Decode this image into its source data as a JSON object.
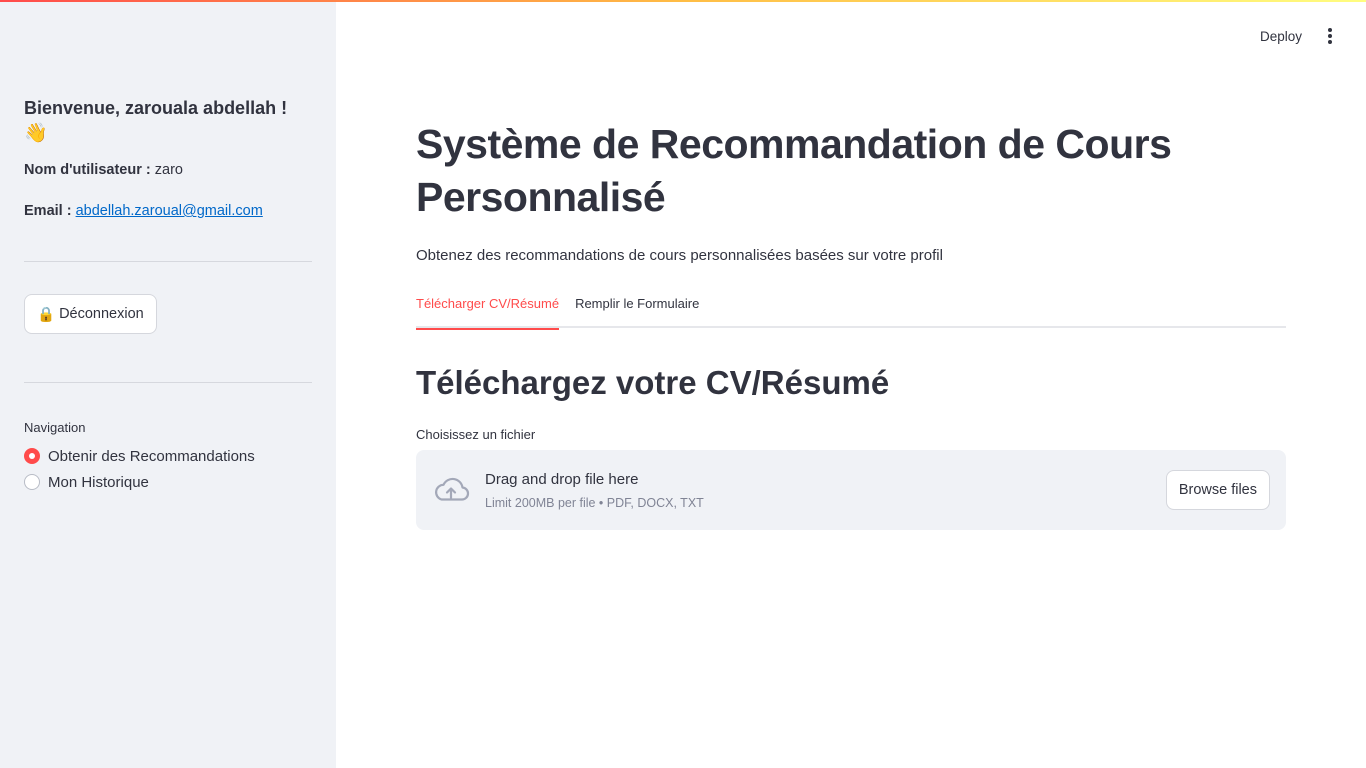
{
  "app": {
    "accent_color": "#ff4b4b",
    "link_color": "#0068c9",
    "sidebar_bg": "#f0f2f6"
  },
  "header": {
    "deploy_label": "Deploy",
    "menu_icon": "kebab-menu-icon"
  },
  "sidebar": {
    "welcome": "Bienvenue, zarouala abdellah !",
    "wave_emoji": "👋",
    "username_label": "Nom d'utilisateur :",
    "username_value": "zaro",
    "email_label": "Email :",
    "email_value": "abdellah.zaroual@gmail.com",
    "logout_icon": "🔒",
    "logout_label": "Déconnexion",
    "nav_title": "Navigation",
    "nav_items": [
      {
        "label": "Obtenir des Recommandations",
        "selected": true
      },
      {
        "label": "Mon Historique",
        "selected": false
      }
    ]
  },
  "main": {
    "title": "Système de Recommandation de Cours Personnalisé",
    "subtitle": "Obtenez des recommandations de cours personnalisées basées sur votre profil",
    "tabs": [
      {
        "label": "Télécharger CV/Résumé",
        "active": true
      },
      {
        "label": "Remplir le Formulaire",
        "active": false
      }
    ],
    "section_title": "Téléchargez votre CV/Résumé",
    "uploader": {
      "label": "Choisissez un fichier",
      "drag_text": "Drag and drop file here",
      "limit_text": "Limit 200MB per file • PDF, DOCX, TXT",
      "browse_label": "Browse files",
      "icon": "cloud-upload-icon"
    }
  }
}
